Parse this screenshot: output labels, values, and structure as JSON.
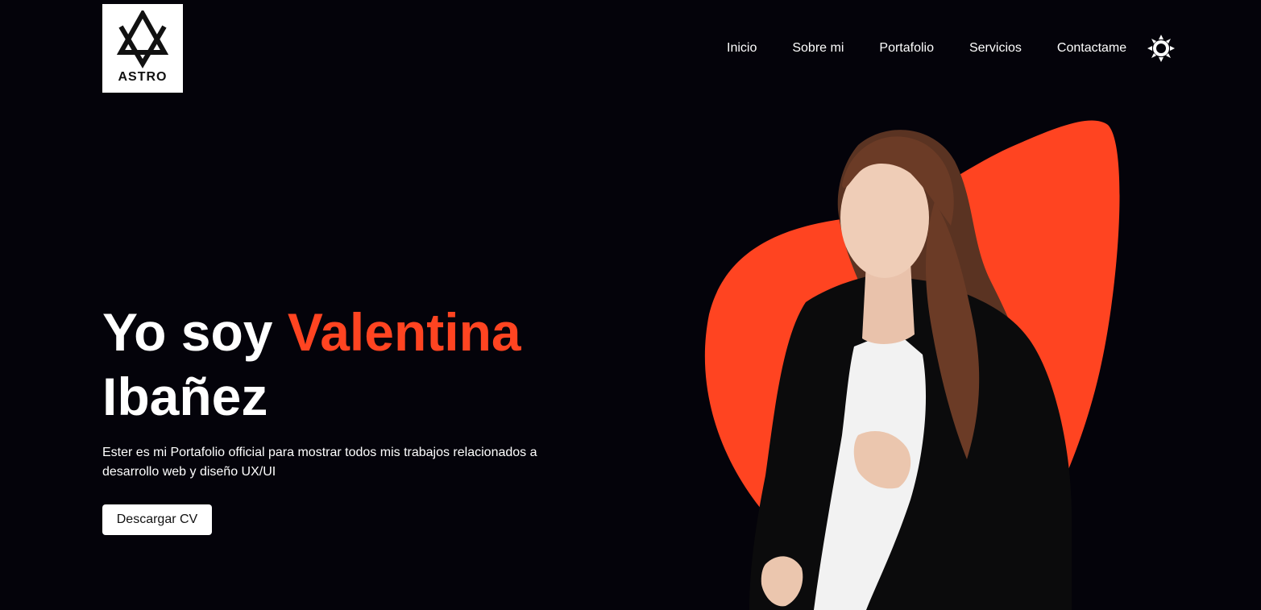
{
  "brand": {
    "logo_text": "ASTRO"
  },
  "nav": {
    "items": [
      {
        "label": "Inicio"
      },
      {
        "label": "Sobre mi"
      },
      {
        "label": "Portafolio"
      },
      {
        "label": "Servicios"
      },
      {
        "label": "Contactame"
      }
    ],
    "theme_toggle_icon": "sun-icon"
  },
  "hero": {
    "title_prefix": "Yo soy ",
    "title_highlight": "Valentina",
    "title_suffix": "Ibañez",
    "description": "Ester es mi Portafolio official para mostrar todos mis trabajos relacionados a desarrollo web y diseño UX/UI",
    "cta_label": "Descargar CV"
  },
  "colors": {
    "background": "#04030a",
    "accent": "#ff4421",
    "text": "#ffffff"
  }
}
